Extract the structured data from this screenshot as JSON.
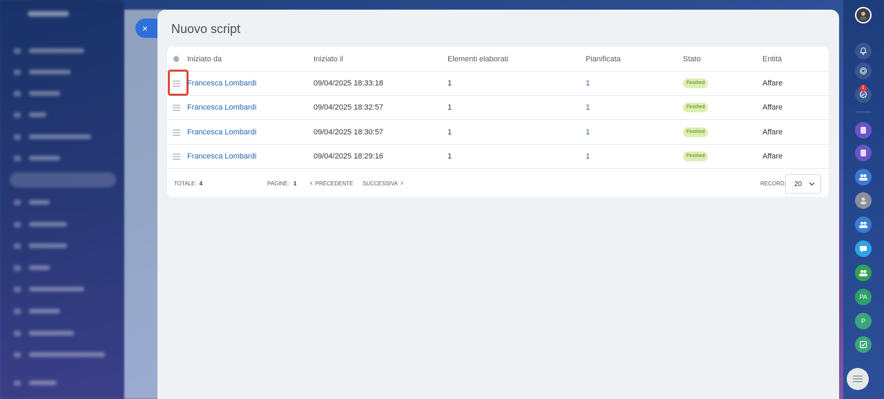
{
  "slider": {
    "title": "Nuovo script",
    "close_label": "×"
  },
  "grid": {
    "columns": [
      "Iniziato da",
      "Iniziato il",
      "Elementi elaborati",
      "Pianificata",
      "Stato",
      "Entità"
    ],
    "rows": [
      {
        "user": "Francesca Lombardi",
        "date": "09/04/2025 18:33:18",
        "elements": "1",
        "scheduled": "1",
        "status": "Finished",
        "entity": "Affare"
      },
      {
        "user": "Francesca Lombardi",
        "date": "09/04/2025 18:32:57",
        "elements": "1",
        "scheduled": "1",
        "status": "Finished",
        "entity": "Affare"
      },
      {
        "user": "Francesca Lombardi",
        "date": "09/04/2025 18:30:57",
        "elements": "1",
        "scheduled": "1",
        "status": "Finished",
        "entity": "Affare"
      },
      {
        "user": "Francesca Lombardi",
        "date": "09/04/2025 18:29:16",
        "elements": "1",
        "scheduled": "1",
        "status": "Finished",
        "entity": "Affare"
      }
    ],
    "footer": {
      "total_label": "TOTALE:",
      "total_value": "4",
      "pages_label": "PAGINE:",
      "pages_value": "1",
      "prev_label": "PRECEDENTE",
      "next_label": "SUCCESSIVA",
      "record_label": "RECORD:",
      "record_value": "20"
    }
  },
  "right_sidebar": {
    "badge_count": "1",
    "avatar_initials_pa": "PA",
    "avatar_initials_p": "P"
  },
  "icons": {
    "gear": "gear-icon",
    "row_menu": "menu-icon",
    "close": "close-icon",
    "bell": "bell-icon",
    "chevron_down": "chevron-down-icon"
  },
  "colors": {
    "link": "#2066b0",
    "badge_bg": "#d9f0b1",
    "highlight": "#e0463c",
    "close_btn": "#2f6fdb"
  }
}
